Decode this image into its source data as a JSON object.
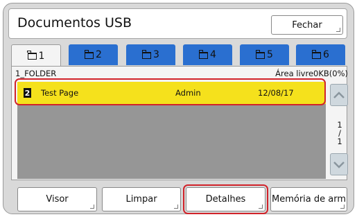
{
  "header": {
    "title": "Documentos USB",
    "close_label": "Fechar"
  },
  "tabs": [
    {
      "label": "1",
      "active": true
    },
    {
      "label": "2",
      "active": false
    },
    {
      "label": "3",
      "active": false
    },
    {
      "label": "4",
      "active": false
    },
    {
      "label": "5",
      "active": false
    },
    {
      "label": "6",
      "active": false
    }
  ],
  "folder": {
    "name": "1_FOLDER",
    "free_area": "Área livre0KB(0%)"
  },
  "list": {
    "items": [
      {
        "count": "2",
        "name": "Test Page",
        "owner": "Admin",
        "date": "12/08/17",
        "selected": true
      }
    ]
  },
  "pager": {
    "current": "1",
    "separator": "/",
    "total": "1"
  },
  "actions": {
    "visor": "Visor",
    "limpar": "Limpar",
    "detalhes": "Detalhes",
    "memoria": "Memória de arm"
  },
  "colors": {
    "tab_blue": "#2a6fd0",
    "selected_row": "#f5e11c",
    "highlight": "#d1232a",
    "list_bg": "#969696"
  }
}
